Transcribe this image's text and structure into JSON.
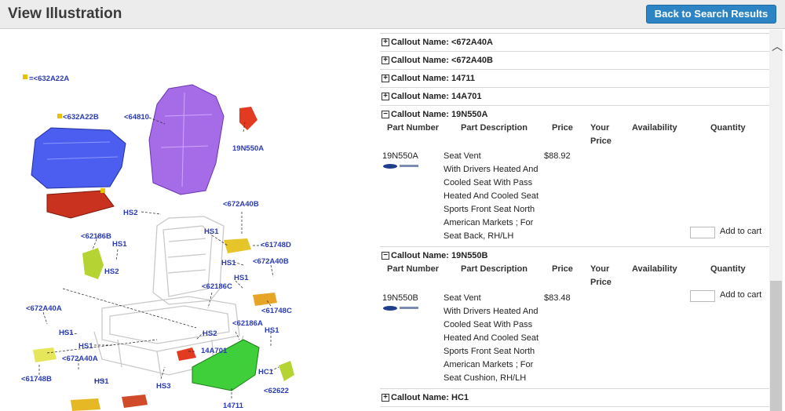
{
  "header": {
    "title": "View Illustration",
    "back_label": "Back to Search Results"
  },
  "illustration": {
    "labels": [
      {
        "text": "=<632A22A"
      },
      {
        "text": "<632A22B"
      },
      {
        "text": "<64810"
      },
      {
        "text": "19N550A"
      },
      {
        "text": "HS2"
      },
      {
        "text": "<672A40B"
      },
      {
        "text": "<62186B"
      },
      {
        "text": "HS1"
      },
      {
        "text": "HS1"
      },
      {
        "text": "<61748D"
      },
      {
        "text": "HS2"
      },
      {
        "text": "HS1"
      },
      {
        "text": "<672A40B"
      },
      {
        "text": "HS1"
      },
      {
        "text": "<62186C"
      },
      {
        "text": "<61748C"
      },
      {
        "text": "<672A40A"
      },
      {
        "text": "HS1"
      },
      {
        "text": "HS2"
      },
      {
        "text": "<62186A"
      },
      {
        "text": "HS1"
      },
      {
        "text": "HS1"
      },
      {
        "text": "14A701"
      },
      {
        "text": "<672A40A"
      },
      {
        "text": "HC1"
      },
      {
        "text": "<61748B"
      },
      {
        "text": "HS1"
      },
      {
        "text": "HS3"
      },
      {
        "text": "<62622"
      },
      {
        "text": "14711"
      }
    ]
  },
  "callouts_top": [
    {
      "icon": "+",
      "label": "Callout Name: <672A40A"
    },
    {
      "icon": "+",
      "label": "Callout Name: <672A40B"
    },
    {
      "icon": "+",
      "label": "Callout Name: 14711"
    },
    {
      "icon": "+",
      "label": "Callout Name: 14A701"
    }
  ],
  "columns": {
    "part_number": "Part Number",
    "description": "Part Description",
    "price": "Price",
    "your_price_1": "Your",
    "your_price_2": "Price",
    "availability": "Availability",
    "quantity": "Quantity"
  },
  "expanded": [
    {
      "icon": "−",
      "label": "Callout Name: 19N550A",
      "part_number": "19N550A",
      "desc": [
        "Seat Vent",
        "With Drivers Heated And",
        "Cooled Seat With Pass",
        "Heated And Cooled Seat",
        "Sports Front Seat North",
        "American Markets ; For",
        "Seat Back, RH/LH"
      ],
      "price": "$88.92",
      "add": "Add to cart"
    },
    {
      "icon": "−",
      "label": "Callout Name: 19N550B",
      "part_number": "19N550B",
      "desc": [
        "Seat Vent",
        "With Drivers Heated And",
        "Cooled Seat With Pass",
        "Heated And Cooled Seat",
        "Sports Front Seat North",
        "American Markets ; For",
        "Seat Cushion, RH/LH"
      ],
      "price": "$83.48",
      "add": "Add to cart"
    }
  ],
  "callouts_bottom": [
    {
      "icon": "+",
      "label": "Callout Name: HC1"
    }
  ],
  "colors": {
    "accent": "#2d84c4",
    "label_blue": "#2a3bb5"
  }
}
